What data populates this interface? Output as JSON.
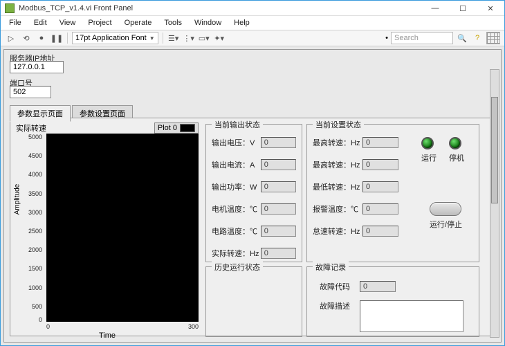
{
  "window": {
    "title": "Modbus_TCP_v1.4.vi Front Panel"
  },
  "menu": {
    "file": "File",
    "edit": "Edit",
    "view": "View",
    "project": "Project",
    "operate": "Operate",
    "tools": "Tools",
    "window": "Window",
    "help": "Help"
  },
  "toolbar": {
    "font": "17pt Application Font",
    "search_placeholder": "Search"
  },
  "inputs": {
    "ip_label": "服务器IP地址",
    "ip_value": "127.0.0.1",
    "port_label": "端口号",
    "port_value": "502"
  },
  "tabs": {
    "display": "参数显示页面",
    "settings": "参数设置页面"
  },
  "plot": {
    "title": "实际转速",
    "legend": "Plot 0",
    "xlabel": "Time",
    "ylabel": "Amplitude",
    "yticks": [
      "5000",
      "4500",
      "4000",
      "3500",
      "3000",
      "2500",
      "2000",
      "1500",
      "1000",
      "500",
      "0"
    ],
    "xticks": [
      "0",
      "300"
    ]
  },
  "output_status": {
    "title": "当前输出状态",
    "voltage_lbl": "输出电压：V",
    "voltage_val": "0",
    "current_lbl": "输出电流：A",
    "current_val": "0",
    "power_lbl": "输出功率：W",
    "power_val": "0",
    "motor_temp_lbl": "电机温度：℃",
    "motor_temp_val": "0",
    "circuit_temp_lbl": "电路温度：℃",
    "circuit_temp_val": "0",
    "speed_lbl": "实际转速：Hz",
    "speed_val": "0"
  },
  "history": {
    "title": "历史运行状态"
  },
  "settings_status": {
    "title": "当前设置状态",
    "max_speed_lbl": "最高转速：Hz",
    "max_speed_val": "0",
    "max_speed2_lbl": "最高转速：Hz",
    "max_speed2_val": "0",
    "min_speed_lbl": "最低转速：Hz",
    "min_speed_val": "0",
    "alarm_temp_lbl": "报警温度：℃",
    "alarm_temp_val": "0",
    "idle_speed_lbl": "怠速转速：Hz",
    "idle_speed_val": "0",
    "led_run": "运行",
    "led_stop": "停机",
    "btn_runstop": "运行/停止"
  },
  "fault": {
    "title": "故障记录",
    "code_lbl": "故障代码",
    "code_val": "0",
    "desc_lbl": "故障描述"
  }
}
